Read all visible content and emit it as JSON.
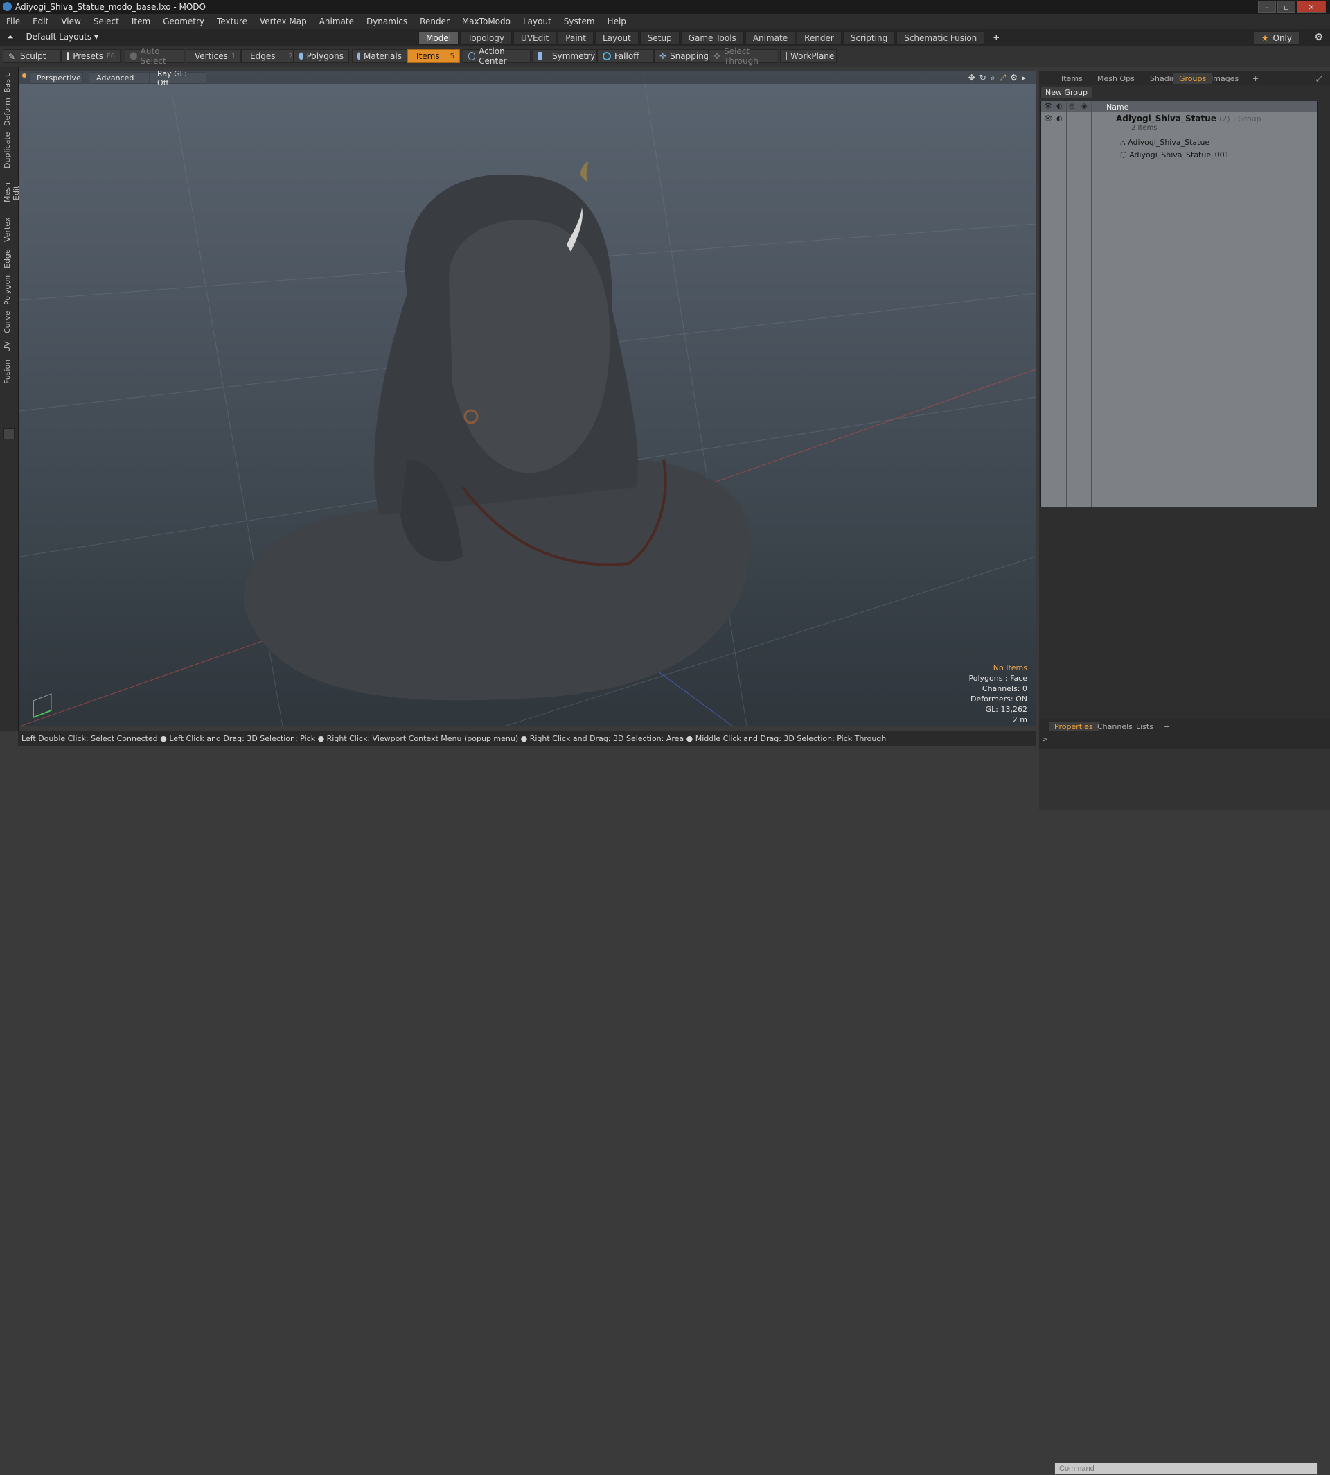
{
  "window": {
    "title": "Adiyogi_Shiva_Statue_modo_base.lxo - MODO"
  },
  "menu": [
    "File",
    "Edit",
    "View",
    "Select",
    "Item",
    "Geometry",
    "Texture",
    "Vertex Map",
    "Animate",
    "Dynamics",
    "Render",
    "MaxToModo",
    "Layout",
    "System",
    "Help"
  ],
  "layout_selector": "Default Layouts",
  "layout_tabs": [
    "Model",
    "Topology",
    "UVEdit",
    "Paint",
    "Layout",
    "Setup",
    "Game Tools",
    "Animate",
    "Render",
    "Scripting",
    "Schematic Fusion"
  ],
  "active_layout_tab": "Model",
  "only_button": "Only",
  "toolbar": {
    "sculpt": "Sculpt",
    "presets": "Presets",
    "presets_hotkey": "F6",
    "auto_select": "Auto Select",
    "vertices": "Vertices",
    "vertices_key": "1",
    "edges": "Edges",
    "edges_key": "2",
    "polygons": "Polygons",
    "materials": "Materials",
    "items": "Items",
    "items_key": "5",
    "action_center": "Action Center",
    "symmetry": "Symmetry",
    "falloff": "Falloff",
    "snapping": "Snapping",
    "select_through": "Select Through",
    "workplane": "WorkPlane"
  },
  "left_tabs": [
    "Basic",
    "Deform",
    "Duplicate",
    "Mesh Edit",
    "Vertex",
    "Edge",
    "Polygon",
    "Curve",
    "UV",
    "Fusion"
  ],
  "viewport": {
    "perspective": "Perspective",
    "advanced": "Advanced",
    "raygl": "Ray GL: Off",
    "info": {
      "no_items": "No Items",
      "polygons": "Polygons : Face",
      "channels": "Channels: 0",
      "deformers": "Deformers: ON",
      "gl": "GL: 13,262",
      "scale": "2 m"
    }
  },
  "status_line": "Left Double Click: Select Connected ● Left Click and Drag: 3D Selection: Pick ● Right Click: Viewport Context Menu (popup menu) ● Right Click and Drag: 3D Selection: Area ● Middle Click and Drag: 3D Selection: Pick Through",
  "right_panel": {
    "tabs": [
      "Items",
      "Mesh Ops",
      "Shading",
      "Groups",
      "Images"
    ],
    "active_tab": "Groups",
    "new_group": "New Group",
    "column_name": "Name",
    "group": {
      "name": "Adiyogi_Shiva_Statue",
      "count": "(2)",
      "type": ": Group",
      "items_label": "2 Items"
    },
    "children": [
      "Adiyogi_Shiva_Statue",
      "Adiyogi_Shiva_Statue_001"
    ],
    "bottom_tabs": [
      "Properties",
      "Channels",
      "Lists"
    ],
    "active_bottom_tab": "Properties",
    "command_placeholder": "Command"
  },
  "colors": {
    "accent": "#e28f29",
    "viewport_top": "#5a6470",
    "viewport_bottom": "#2f363c"
  }
}
